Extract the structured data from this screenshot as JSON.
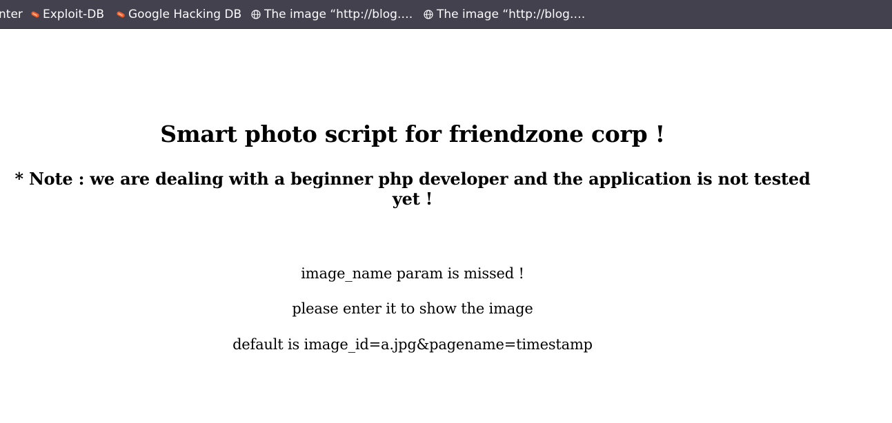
{
  "bookmarks": [
    {
      "label": "nter",
      "icon": "none"
    },
    {
      "label": "Exploit-DB",
      "icon": "exploit-db-icon"
    },
    {
      "label": "Google Hacking DB",
      "icon": "exploit-db-icon"
    },
    {
      "label": "The image “http://blog.…",
      "icon": "globe-icon"
    },
    {
      "label": "The image “http://blog.…",
      "icon": "globe-icon"
    }
  ],
  "page": {
    "title": "Smart photo script for friendzone corp !",
    "note": "* Note : we are dealing with a beginner php developer and the application is not tested yet !",
    "messages": [
      "image_name param is missed !",
      "please enter it to show the image",
      "default is image_id=a.jpg&pagename=timestamp"
    ]
  },
  "colors": {
    "toolbar_bg": "#42414d",
    "toolbar_text": "#fbfbfe",
    "exploit_icon": "#f25a29",
    "page_bg": "#ffffff"
  }
}
